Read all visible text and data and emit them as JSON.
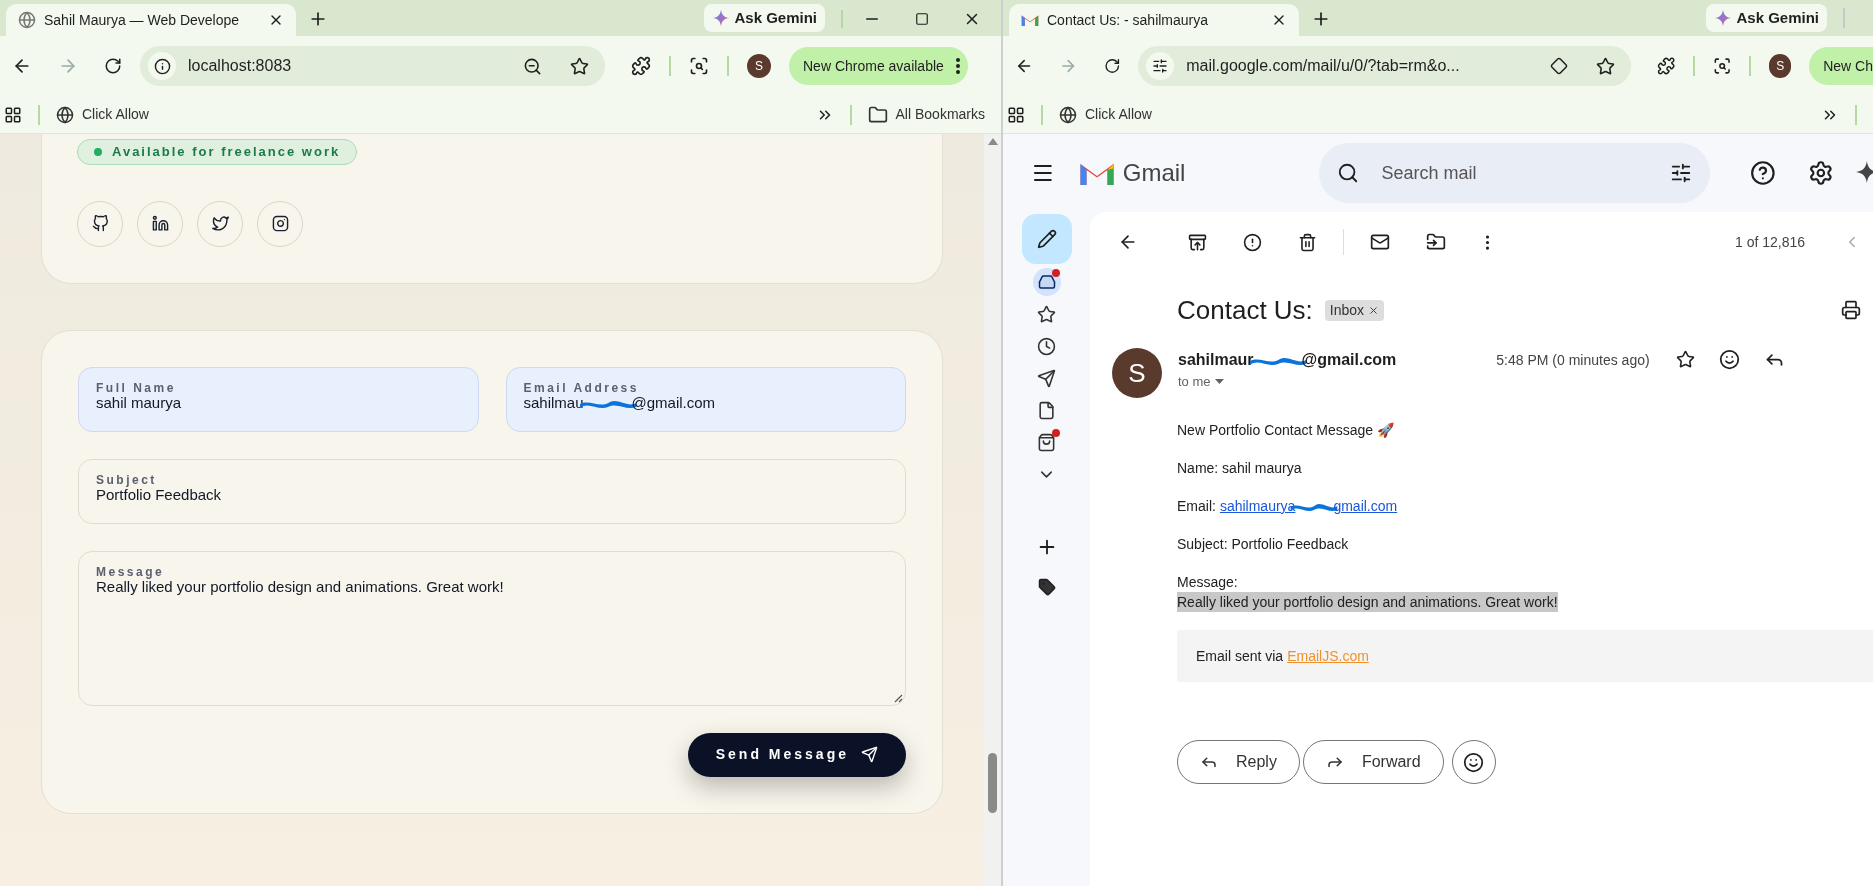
{
  "left_window": {
    "tab": {
      "title": "Sahil Maurya — Web Develope",
      "selected": true
    },
    "ask_gemini": "Ask Gemini",
    "address": "localhost:8083",
    "profile_initial": "S",
    "update_button": "New Chrome available",
    "bookmark": "Click Allow",
    "all_bookmarks": "All Bookmarks",
    "page": {
      "badge": "Available for freelance work",
      "socials": [
        {
          "kind": "github"
        },
        {
          "kind": "linkedin"
        },
        {
          "kind": "twitter"
        },
        {
          "kind": "instagram"
        }
      ],
      "fields": [
        {
          "kind": "input",
          "label": "Full Name",
          "value_parts": [
            "sahil maurya"
          ],
          "autofilled": true
        },
        {
          "kind": "input",
          "label": "Email Address",
          "value_parts": [
            "sahilmau",
            "@gmail.com"
          ],
          "autofilled": true
        },
        {
          "kind": "input",
          "label": "Subject",
          "value_parts": [
            "Portfolio Feedback"
          ],
          "autofilled": false
        },
        {
          "kind": "textarea",
          "label": "Message",
          "value_parts": [
            "Really liked your portfolio design and animations. Great work!"
          ],
          "autofilled": false
        }
      ],
      "submit": "Send Message"
    }
  },
  "right_window": {
    "tab": {
      "title": "Contact Us: - sahilmaurya",
      "selected": true
    },
    "ask_gemini": "Ask Gemini",
    "address": "mail.google.com/mail/u/0/?tab=rm&o...",
    "profile_initial": "S",
    "update_button": "New Ch",
    "bookmark": "Click Allow",
    "gmail": {
      "logo": "Gmail",
      "search": {
        "placeholder": "Search mail"
      },
      "nav": [
        {
          "kind": "inbox",
          "selected": true,
          "dot": true
        },
        {
          "kind": "starred",
          "selected": false,
          "dot": false
        },
        {
          "kind": "snoozed",
          "selected": false,
          "dot": false
        },
        {
          "kind": "sent",
          "selected": false,
          "dot": false
        },
        {
          "kind": "drafts",
          "selected": false,
          "dot": false
        },
        {
          "kind": "purchases",
          "selected": false,
          "dot": true
        },
        {
          "kind": "more",
          "selected": false,
          "dot": false
        }
      ],
      "counter": "1 of 12,816",
      "subject": "Contact Us:",
      "label": "Inbox",
      "sender_initial": "S",
      "sender_parts": [
        "sahilmaur",
        "@gmail.com"
      ],
      "time": "5:48 PM (0 minutes ago)",
      "recipient": "to me",
      "body": {
        "heading": "New Portfolio Contact Message 🚀",
        "name_line": "Name: sahil maurya",
        "email_prefix": "Email:",
        "email_link_parts": [
          "sahilmaurya",
          "gmail.com"
        ],
        "subject_line": "Subject: Portfolio Feedback",
        "message_label": "Message:",
        "message": {
          "text": "Really liked your portfolio design and animations. Great work!",
          "selected": true
        },
        "footer_prefix": "Email sent via",
        "footer_link": "EmailJS.com"
      },
      "actions": [
        "Reply",
        "Forward"
      ]
    }
  }
}
